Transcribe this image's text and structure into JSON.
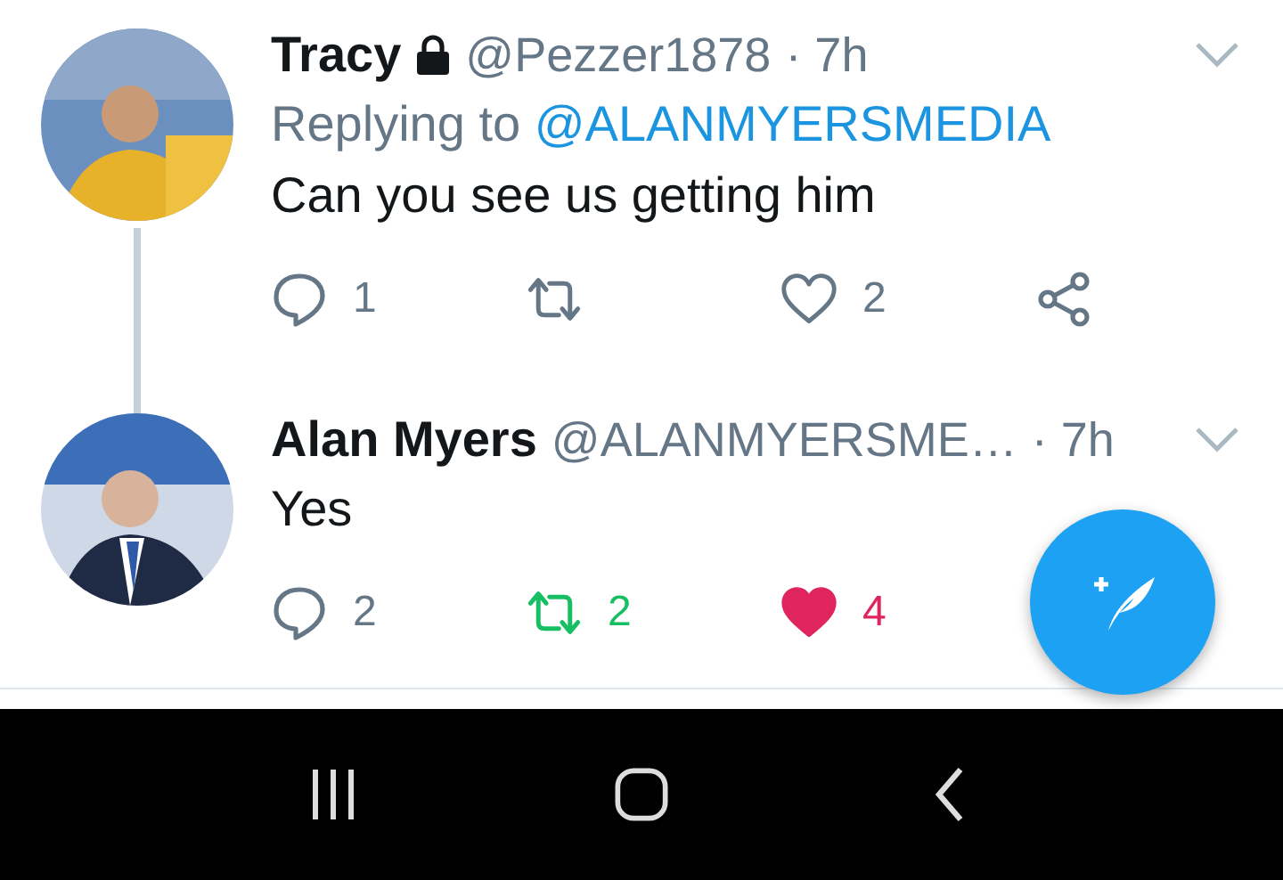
{
  "tweets": [
    {
      "name": "Tracy",
      "locked": true,
      "handle": "@Pezzer1878",
      "time": "· 7h",
      "replying_prefix": "Replying to ",
      "replying_to": "@ALANMYERSMEDIA",
      "text": "Can you see us getting him",
      "thread_below": true,
      "actions": [
        {
          "kind": "reply",
          "count": "1"
        },
        {
          "kind": "retweet",
          "active": false
        },
        {
          "kind": "like",
          "count": "2",
          "active": false
        },
        {
          "kind": "share"
        }
      ]
    },
    {
      "name": "Alan Myers",
      "locked": false,
      "handle": "@ALANMYERSME…",
      "time": "· 7h",
      "text": "Yes",
      "thread_below": false,
      "actions": [
        {
          "kind": "reply",
          "count": "2"
        },
        {
          "kind": "retweet",
          "count": "2",
          "active": true
        },
        {
          "kind": "like",
          "count": "4",
          "active": true
        }
      ]
    }
  ]
}
